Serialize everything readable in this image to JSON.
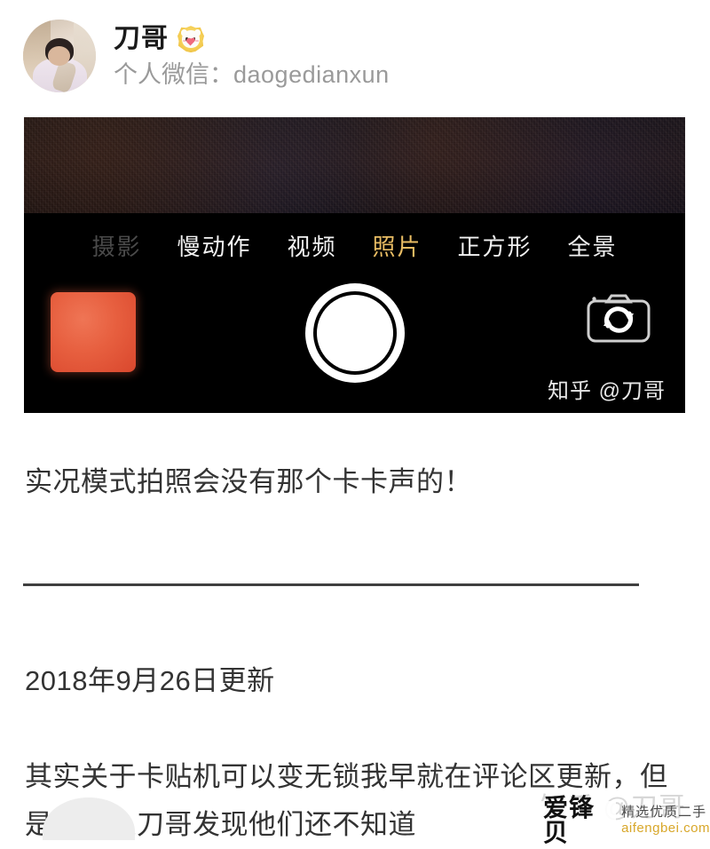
{
  "author": {
    "name": "刀哥",
    "badge_icon": "gold-verified-badge",
    "avatar_icon": "user-avatar-photo",
    "subtitle_label": "个人微信：",
    "subtitle_value": "daogedianxun"
  },
  "camera_shot": {
    "modes": [
      {
        "label": "摄影",
        "state": "dim"
      },
      {
        "label": "慢动作",
        "state": "normal"
      },
      {
        "label": "视频",
        "state": "normal"
      },
      {
        "label": "照片",
        "state": "active"
      },
      {
        "label": "正方形",
        "state": "normal"
      },
      {
        "label": "全景",
        "state": "normal"
      }
    ],
    "thumbnail_icon": "last-photo-thumbnail",
    "shutter_icon": "shutter-button",
    "flip_icon": "flip-camera-icon",
    "watermark": "知乎 @刀哥",
    "colors": {
      "active_mode": "#e8bc63",
      "dim_mode": "#4a4a4a",
      "thumbnail": "#e75f3f",
      "background": "#000000"
    }
  },
  "content": {
    "caption": "实况模式拍照会没有那个卡卡声的！",
    "date_heading": "2018年9月26日更新",
    "paragraph": "其实关于卡贴机可以变无锁我早就在评论区更新，但是好多人刀哥发现他们还不知道"
  },
  "watermarks": {
    "zhihu_faint": "知乎 @刀哥",
    "aifengbei_logo": "爱锋贝",
    "aifengbei_tagline": "精选优质二手",
    "aifengbei_url": "aifengbei.com",
    "url_color": "#d8a72a"
  }
}
